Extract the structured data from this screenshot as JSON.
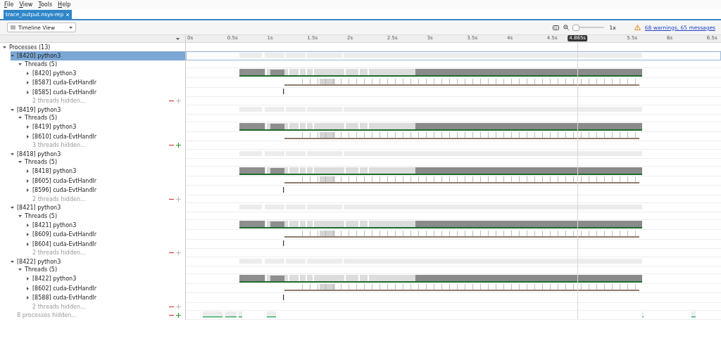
{
  "menu": [
    {
      "label": "File"
    },
    {
      "label": "View"
    },
    {
      "label": "Tools"
    },
    {
      "label": "Help"
    }
  ],
  "tabs": [
    {
      "label": "trace_output.nsys-rep",
      "selected": true
    }
  ],
  "toolbar": {
    "view": "Timeline View",
    "zoom": {
      "level": 0,
      "reading": "1x"
    },
    "status_link": "68 warnings, 65 messages"
  },
  "timeline": {
    "ticks": [
      {
        "kind": "tick",
        "label": "0s"
      },
      {
        "kind": "tick",
        "label": "0.5s"
      },
      {
        "kind": "tick",
        "label": "1s"
      },
      {
        "kind": "tick",
        "label": "1.5s"
      },
      {
        "kind": "tick",
        "label": "2s"
      },
      {
        "kind": "tick",
        "label": "2.5s"
      },
      {
        "kind": "tick",
        "label": "3s"
      },
      {
        "kind": "tick",
        "label": "3.5s"
      },
      {
        "kind": "tick",
        "label": "4s"
      },
      {
        "kind": "tick",
        "label": "4.5s"
      },
      {
        "kind": "cursor",
        "label": "4.865s"
      },
      {
        "kind": "tick",
        "label": "5.5s"
      },
      {
        "kind": "tick",
        "label": "6s"
      },
      {
        "kind": "tick",
        "label": "6.5s"
      }
    ]
  },
  "tree": {
    "label": "Processes (13)",
    "expanded": true,
    "selected": false,
    "children": [
      {
        "label": "[8420] python3",
        "kind": "process",
        "expanded": true,
        "selected": true,
        "children": [
          {
            "label": "Threads (5)",
            "expanded": true,
            "selected": false,
            "children": [
              {
                "label": "[8420] python3",
                "kind": "busy",
                "expanded": false,
                "selected": false
              },
              {
                "label": "[8587] cuda-EvtHandlr",
                "kind": "events",
                "expanded": false,
                "selected": false
              },
              {
                "label": "[8585] cuda-EvtHandlr",
                "kind": "idle",
                "expanded": false,
                "selected": false
              },
              {
                "label": "2 threads hidden...",
                "kind": "hidden",
                "more_enabled": false
              }
            ]
          }
        ]
      },
      {
        "label": "[8419] python3",
        "kind": "process",
        "expanded": true,
        "selected": false,
        "children": [
          {
            "label": "Threads (5)",
            "expanded": true,
            "selected": false,
            "children": [
              {
                "label": "[8419] python3",
                "kind": "busy",
                "expanded": false,
                "selected": false
              },
              {
                "label": "[8610] cuda-EvtHandlr",
                "kind": "events",
                "expanded": false,
                "selected": false
              },
              {
                "label": "3 threads hidden...",
                "kind": "hidden",
                "more_enabled": true
              }
            ]
          }
        ]
      },
      {
        "label": "[8418] python3",
        "kind": "process",
        "expanded": true,
        "selected": false,
        "children": [
          {
            "label": "Threads (5)",
            "expanded": true,
            "selected": false,
            "children": [
              {
                "label": "[8418] python3",
                "kind": "busy",
                "expanded": false,
                "selected": false
              },
              {
                "label": "[8605] cuda-EvtHandlr",
                "kind": "events",
                "expanded": false,
                "selected": false
              },
              {
                "label": "[8596] cuda-EvtHandlr",
                "kind": "idle",
                "expanded": false,
                "selected": false
              },
              {
                "label": "2 threads hidden...",
                "kind": "hidden",
                "more_enabled": false
              }
            ]
          }
        ]
      },
      {
        "label": "[8421] python3",
        "kind": "process",
        "expanded": true,
        "selected": false,
        "children": [
          {
            "label": "Threads (5)",
            "expanded": true,
            "selected": false,
            "children": [
              {
                "label": "[8421] python3",
                "kind": "busy",
                "expanded": false,
                "selected": false
              },
              {
                "label": "[8609] cuda-EvtHandlr",
                "kind": "events",
                "expanded": false,
                "selected": false
              },
              {
                "label": "[8604] cuda-EvtHandlr",
                "kind": "idle",
                "expanded": false,
                "selected": false
              },
              {
                "label": "2 threads hidden...",
                "kind": "hidden",
                "more_enabled": false
              }
            ]
          }
        ]
      },
      {
        "label": "[8422] python3",
        "kind": "process",
        "expanded": true,
        "selected": false,
        "children": [
          {
            "label": "Threads (5)",
            "expanded": true,
            "selected": false,
            "children": [
              {
                "label": "[8422] python3",
                "kind": "busy",
                "expanded": false,
                "selected": false
              },
              {
                "label": "[8602] cuda-EvtHandlr",
                "kind": "events",
                "expanded": false,
                "selected": false
              },
              {
                "label": "[8588] cuda-EvtHandlr",
                "kind": "idle",
                "expanded": false,
                "selected": false
              },
              {
                "label": "2 threads hidden...",
                "kind": "hidden",
                "more_enabled": false
              }
            ]
          }
        ]
      },
      {
        "label": "8 processes hidden...",
        "kind": "hidden",
        "more_enabled": true
      }
    ]
  }
}
